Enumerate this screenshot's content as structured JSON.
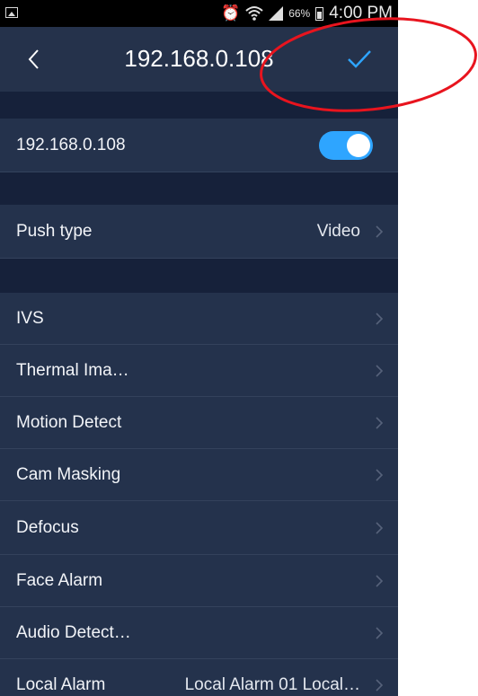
{
  "status_bar": {
    "battery": "66%",
    "time": "4:00 PM",
    "icons": [
      "gallery-icon",
      "alarm-clock-icon",
      "wifi-icon",
      "signal-icon",
      "battery-icon"
    ]
  },
  "header": {
    "title": "192.168.0.108",
    "back_icon": "chevron-left-icon",
    "confirm_icon": "checkmark-icon"
  },
  "device_row": {
    "label": "192.168.0.108",
    "enabled": true
  },
  "push_row": {
    "label": "Push type",
    "value": "Video"
  },
  "menu": [
    {
      "label": "IVS"
    },
    {
      "label": "Thermal Ima…"
    },
    {
      "label": "Motion Detect"
    },
    {
      "label": "Cam Masking"
    },
    {
      "label": "Defocus"
    },
    {
      "label": "Face Alarm"
    },
    {
      "label": "Audio Detect…"
    },
    {
      "label": "Local Alarm",
      "value": "Local Alarm 01  Local…"
    }
  ],
  "colors": {
    "background": "#1c2840",
    "row": "#24324c",
    "accent": "#2ea5ff",
    "annotation": "#e8141e"
  }
}
